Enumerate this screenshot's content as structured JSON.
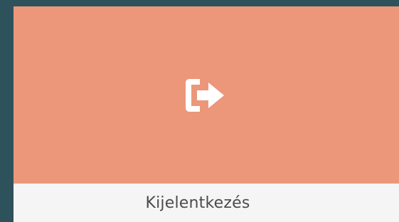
{
  "tile": {
    "label": "Kijelentkezés",
    "icon": "sign-out-icon",
    "accent_color": "#ec977a",
    "label_bar_color": "#f5f5f5",
    "background_color": "#2e525c"
  }
}
